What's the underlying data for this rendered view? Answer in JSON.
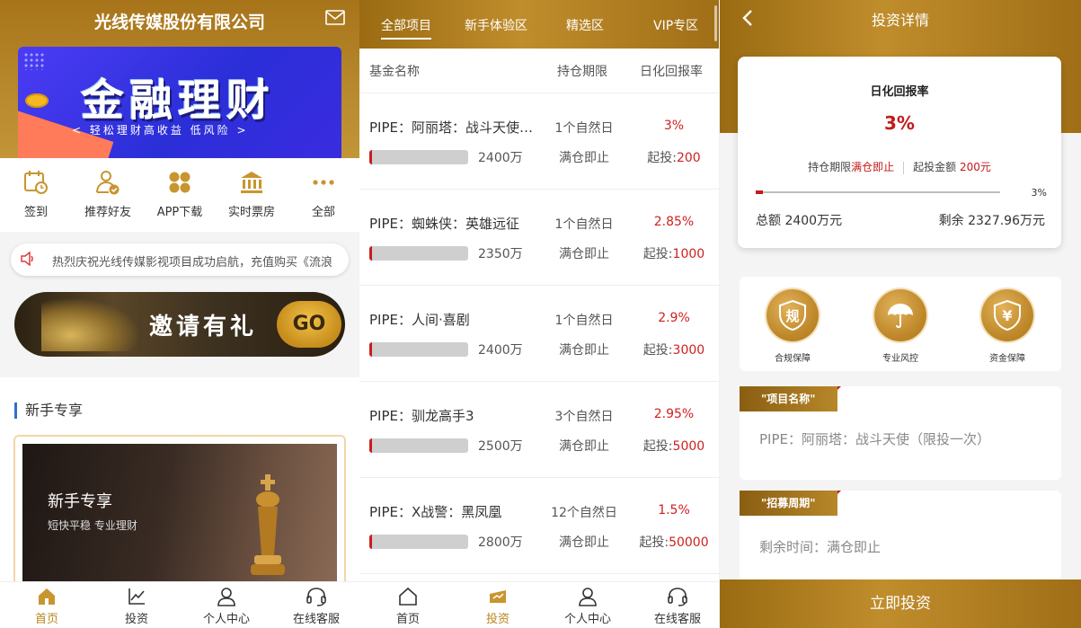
{
  "home": {
    "company_title": "光线传媒股份有限公司",
    "banner": {
      "title": "金融理财",
      "subtitle": "< 轻松理财高收益  低风险 >"
    },
    "quick_items": [
      {
        "label": "签到",
        "icon": "calendar-clock-icon"
      },
      {
        "label": "推荐好友",
        "icon": "user-check-icon"
      },
      {
        "label": "APP下载",
        "icon": "app-grid-icon"
      },
      {
        "label": "实时票房",
        "icon": "bank-icon"
      },
      {
        "label": "全部",
        "icon": "more-dots-icon"
      }
    ],
    "notice": "热烈庆祝光线传媒影视项目成功启航，充值购买《流浪",
    "invite": {
      "text": "邀请有礼",
      "go": "GO"
    },
    "novice": {
      "section_title": "新手专享",
      "card_title": "新手专享",
      "card_subtitle": "短快平稳 专业理财"
    },
    "tabs": [
      "首页",
      "投资",
      "个人中心",
      "在线客服"
    ]
  },
  "invest": {
    "tabs": [
      "全部项目",
      "新手体验区",
      "精选区",
      "VIP专区"
    ],
    "headers": {
      "name": "基金名称",
      "period": "持仓期限",
      "rate": "日化回报率"
    },
    "funds": [
      {
        "name": "PIPE：阿丽塔：战斗天使（限投一次）",
        "period": "1个自然日",
        "rate": "3%",
        "amount": "2400万",
        "close": "满仓即止",
        "min_label": "起投:",
        "min_value": "200",
        "progress": 0.03
      },
      {
        "name": "PIPE：蜘蛛侠：英雄远征",
        "period": "1个自然日",
        "rate": "2.85%",
        "amount": "2350万",
        "close": "满仓即止",
        "min_label": "起投:",
        "min_value": "1000",
        "progress": 0.03
      },
      {
        "name": "PIPE：人间·喜剧",
        "period": "1个自然日",
        "rate": "2.9%",
        "amount": "2400万",
        "close": "满仓即止",
        "min_label": "起投:",
        "min_value": "3000",
        "progress": 0.03
      },
      {
        "name": "PIPE：驯龙高手3",
        "period": "3个自然日",
        "rate": "2.95%",
        "amount": "2500万",
        "close": "满仓即止",
        "min_label": "起投:",
        "min_value": "5000",
        "progress": 0.03
      },
      {
        "name": "PIPE：X战警：黑凤凰",
        "period": "12个自然日",
        "rate": "1.5%",
        "amount": "2800万",
        "close": "满仓即止",
        "min_label": "起投:",
        "min_value": "50000",
        "progress": 0.03
      }
    ],
    "bottom_tabs": [
      "首页",
      "投资",
      "个人中心",
      "在线客服"
    ]
  },
  "detail": {
    "title": "投资详情",
    "rate_label": "日化回报率",
    "rate_value": "3%",
    "period_label": "持仓期限",
    "period_value": "满仓即止",
    "min_label": "起投金额",
    "min_value": "200元",
    "progress_label": "3%",
    "progress": 0.03,
    "total_label": "总额",
    "total_value": "2400万元",
    "remain_label": "剩余",
    "remain_value": "2327.96万元",
    "guarantees": [
      {
        "label": "合规保障",
        "glyph": "规"
      },
      {
        "label": "专业风控",
        "icon": "umbrella-icon"
      },
      {
        "label": "资金保障",
        "glyph": "¥"
      }
    ],
    "project_tag": "\"项目名称\"",
    "project_name": "PIPE：阿丽塔：战斗天使（限投一次）",
    "period_tag": "\"招募周期\"",
    "remain_time": "剩余时间：满仓即止",
    "invest_button": "立即投资"
  },
  "colors": {
    "gold": "#b8861f",
    "red": "#c31a1a",
    "blue_accent": "#2f6fd0"
  }
}
